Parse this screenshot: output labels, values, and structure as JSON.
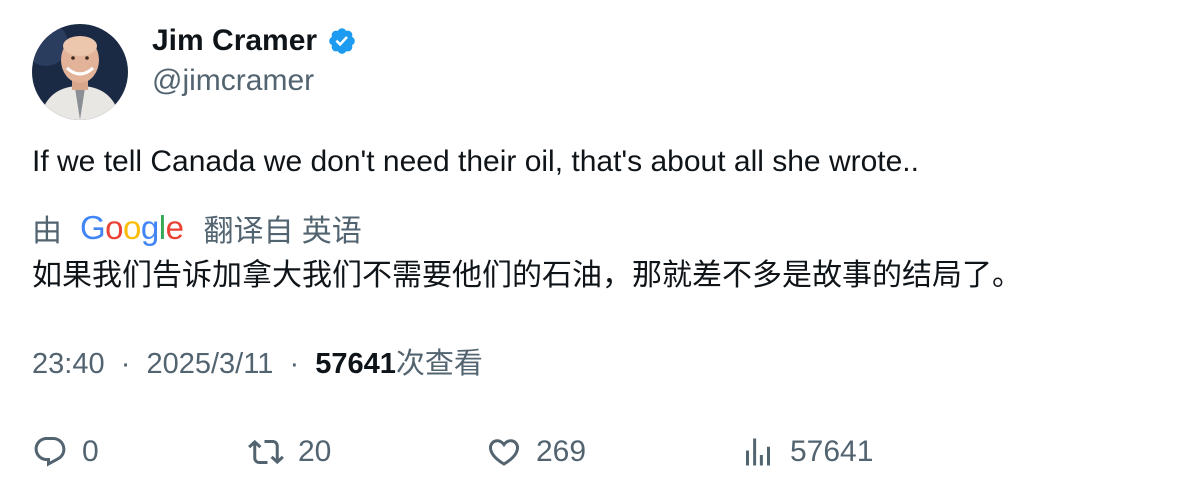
{
  "author": {
    "display_name": "Jim Cramer",
    "handle": "@jimcramer",
    "verified": true
  },
  "tweet": {
    "text": "If we tell Canada we don't need their oil, that's about all she wrote.."
  },
  "translation": {
    "by_label": "由",
    "provider": "Google",
    "from_label": "翻译自 英语",
    "text": "如果我们告诉加拿大我们不需要他们的石油，那就差不多是故事的结局了。"
  },
  "meta": {
    "time": "23:40",
    "separator": "·",
    "date": "2025/3/11",
    "views_count": "57641",
    "views_label": "次查看"
  },
  "actions": {
    "replies": "0",
    "retweets": "20",
    "likes": "269",
    "views": "57641"
  },
  "colors": {
    "verified": "#1d9bf0",
    "muted": "#536471",
    "text": "#0f1419"
  },
  "icons": {
    "reply": "reply-icon",
    "retweet": "retweet-icon",
    "like": "heart-icon",
    "views": "analytics-icon",
    "verified": "verified-badge-icon"
  }
}
